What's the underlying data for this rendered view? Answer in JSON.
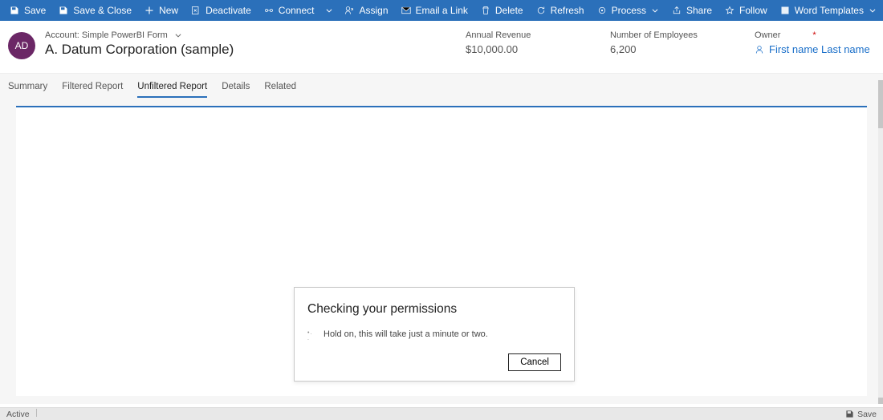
{
  "toolbar": {
    "save": "Save",
    "save_close": "Save & Close",
    "new": "New",
    "deactivate": "Deactivate",
    "connect": "Connect",
    "assign": "Assign",
    "email_link": "Email a Link",
    "delete": "Delete",
    "refresh": "Refresh",
    "process": "Process",
    "share": "Share",
    "follow": "Follow",
    "word_templates": "Word Templates"
  },
  "header": {
    "avatar_initials": "AD",
    "breadcrumb": "Account: Simple PowerBI Form",
    "title": "A. Datum Corporation (sample)",
    "fields": {
      "revenue_label": "Annual Revenue",
      "revenue_value": "$10,000.00",
      "employees_label": "Number of Employees",
      "employees_value": "6,200",
      "owner_label": "Owner",
      "owner_value": "First name Last name"
    }
  },
  "tabs": {
    "items": [
      {
        "label": "Summary"
      },
      {
        "label": "Filtered Report"
      },
      {
        "label": "Unfiltered Report",
        "active": true
      },
      {
        "label": "Details"
      },
      {
        "label": "Related"
      }
    ]
  },
  "dialog": {
    "title": "Checking your permissions",
    "body": "Hold on, this will take just a minute or two.",
    "cancel": "Cancel"
  },
  "status": {
    "left": "Active",
    "save": "Save"
  }
}
